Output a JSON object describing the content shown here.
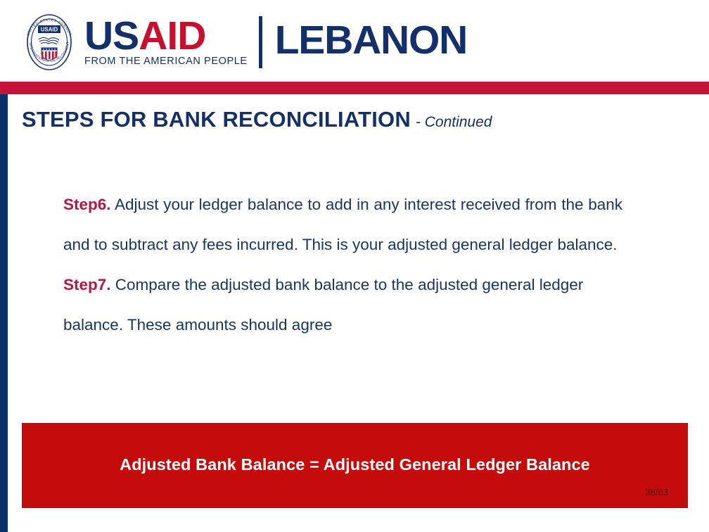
{
  "header": {
    "seal": {
      "top_arc_text": "UNITED STATES AGENCY",
      "bottom_arc_text": "INTERNATIONAL DEVELOPMENT",
      "center_label": "USAID",
      "emblem": "handshake-and-shield"
    },
    "wordmark_us": "US",
    "wordmark_aid": "AID",
    "tagline": "FROM THE AMERICAN PEOPLE",
    "country": "LEBANON"
  },
  "title": {
    "main": "STEPS FOR BANK  RECONCILIATION",
    "suffix": "- Continued"
  },
  "body": {
    "paragraphs": [
      {
        "label": "Step6.",
        "text": " Adjust your ledger balance to add in any interest received from the bank and to subtract any fees incurred. This is your adjusted general ledger balance."
      },
      {
        "label": "Step7.",
        "text": " Compare the adjusted bank balance to the adjusted general ledger balance. These amounts should agree"
      }
    ]
  },
  "callout": {
    "text": "Adjusted Bank Balance = Adjusted General Ledger Balance"
  },
  "footer": {
    "page_number": "38/63"
  },
  "colors": {
    "navy": "#14306b",
    "crimson_band": "#c41239",
    "step_label": "#b5173f",
    "callout_red": "#c40c0c",
    "body_text": "#18355f",
    "usaid_red": "#c8102e"
  }
}
